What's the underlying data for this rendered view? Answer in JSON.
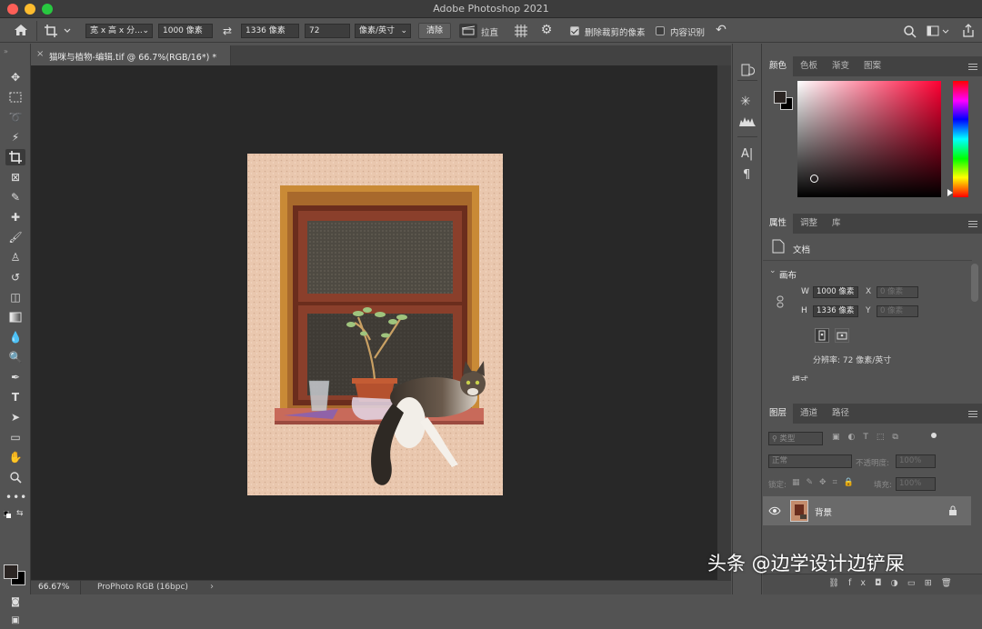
{
  "window": {
    "title": "Adobe Photoshop 2021"
  },
  "options_bar": {
    "ratio_preset": "宽 x 高 x 分...",
    "width_value": "1000 像素",
    "height_value": "1336 像素",
    "resolution_value": "72",
    "resolution_unit": "像素/英寸",
    "clear_label": "清除",
    "straighten_label": "拉直",
    "delete_cropped_label": "删除裁剪的像素",
    "delete_cropped_checked": true,
    "content_aware_label": "内容识别",
    "content_aware_checked": false
  },
  "document": {
    "tab_title": "猫咪与植物-编辑.tif @ 66.7%(RGB/16*) *"
  },
  "status": {
    "zoom": "66.67%",
    "profile": "ProPhoto RGB (16bpc)",
    "arrow": "›"
  },
  "color_panel": {
    "tabs": [
      "颜色",
      "色板",
      "渐变",
      "图案"
    ],
    "foreground": "#2b2523",
    "background": "#000000",
    "hue_color": "#ff0033"
  },
  "properties_panel": {
    "tabs": [
      "属性",
      "调整",
      "库"
    ],
    "doc_label": "文档",
    "canvas_heading": "画布",
    "w_label": "W",
    "w_value": "1000 像素",
    "h_label": "H",
    "h_value": "1336 像素",
    "x_label": "X",
    "x_value": "0 像素",
    "y_label": "Y",
    "y_value": "0 像素",
    "resolution": "分辨率: 72 像素/英寸",
    "mode_label": "模式"
  },
  "layers_panel": {
    "tabs": [
      "图层",
      "通道",
      "路径"
    ],
    "filter_placeholder": "类型",
    "blend_mode": "正常",
    "opacity_label": "不透明度:",
    "opacity_value": "100%",
    "lock_label": "锁定:",
    "fill_label": "填充:",
    "fill_value": "100%",
    "layers": [
      {
        "name": "背景",
        "visible": true,
        "locked": true
      }
    ]
  },
  "watermark": {
    "text": "头条 @边学设计边铲屎"
  }
}
